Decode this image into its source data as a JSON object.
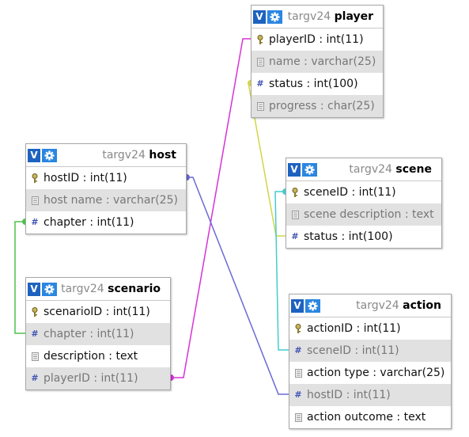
{
  "tables": [
    {
      "id": "player",
      "schema": "targv24",
      "name": "player",
      "fields": [
        {
          "text": "playerID : int(11)",
          "icon": "primary-key-icon",
          "alt": false
        },
        {
          "text": "name : varchar(25)",
          "icon": "text-field-icon",
          "alt": true
        },
        {
          "text": "status : int(100)",
          "icon": "number-field-icon",
          "alt": false
        },
        {
          "text": "progress : char(25)",
          "icon": "text-field-icon",
          "alt": true
        }
      ]
    },
    {
      "id": "host",
      "schema": "targv24",
      "name": "host",
      "fields": [
        {
          "text": "hostID : int(11)",
          "icon": "primary-key-icon",
          "alt": false
        },
        {
          "text": "host name : varchar(25)",
          "icon": "text-field-icon",
          "alt": true
        },
        {
          "text": "chapter : int(11)",
          "icon": "number-field-icon",
          "alt": false
        }
      ]
    },
    {
      "id": "scene",
      "schema": "targv24",
      "name": "scene",
      "fields": [
        {
          "text": "sceneID : int(11)",
          "icon": "primary-key-icon",
          "alt": false
        },
        {
          "text": "scene description : text",
          "icon": "text-field-icon",
          "alt": true
        },
        {
          "text": "status : int(100)",
          "icon": "number-field-icon",
          "alt": false
        }
      ]
    },
    {
      "id": "scenario",
      "schema": "targv24",
      "name": "scenario",
      "fields": [
        {
          "text": "scenarioID : int(11)",
          "icon": "primary-key-icon",
          "alt": false
        },
        {
          "text": "chapter : int(11)",
          "icon": "number-field-icon",
          "alt": true
        },
        {
          "text": "description : text",
          "icon": "text-field-icon",
          "alt": false
        },
        {
          "text": "playerID : int(11)",
          "icon": "number-field-icon",
          "alt": true
        }
      ]
    },
    {
      "id": "action",
      "schema": "targv24",
      "name": "action",
      "fields": [
        {
          "text": "actionID : int(11)",
          "icon": "primary-key-icon",
          "alt": false
        },
        {
          "text": "sceneID : int(11)",
          "icon": "number-field-icon",
          "alt": true
        },
        {
          "text": "action type : varchar(25)",
          "icon": "text-field-icon",
          "alt": false
        },
        {
          "text": "hostID : int(11)",
          "icon": "number-field-icon",
          "alt": true
        },
        {
          "text": "action outcome : text",
          "icon": "text-field-icon",
          "alt": false
        }
      ]
    }
  ],
  "header_icons": {
    "v_label": "V",
    "settings_icon": "gear-icon"
  },
  "relations": [
    {
      "from": "scenario.playerID",
      "to": "player.playerID",
      "color": "#d633d6"
    },
    {
      "from": "scene.status",
      "to": "player.status",
      "color": "#d4d44a"
    },
    {
      "from": "scenario.chapter",
      "to": "host.chapter",
      "color": "#4cc24c"
    },
    {
      "from": "action.hostID",
      "to": "host.hostID",
      "color": "#6a6ad4"
    },
    {
      "from": "action.sceneID",
      "to": "scene.sceneID",
      "color": "#44cccc"
    }
  ],
  "colors": {
    "header_v": "#1e62c0",
    "header_gear": "#2a86e0",
    "alt_row": "#e1e1e1",
    "key_icon": "#9a8a3a",
    "number_icon": "#3f53b4"
  }
}
